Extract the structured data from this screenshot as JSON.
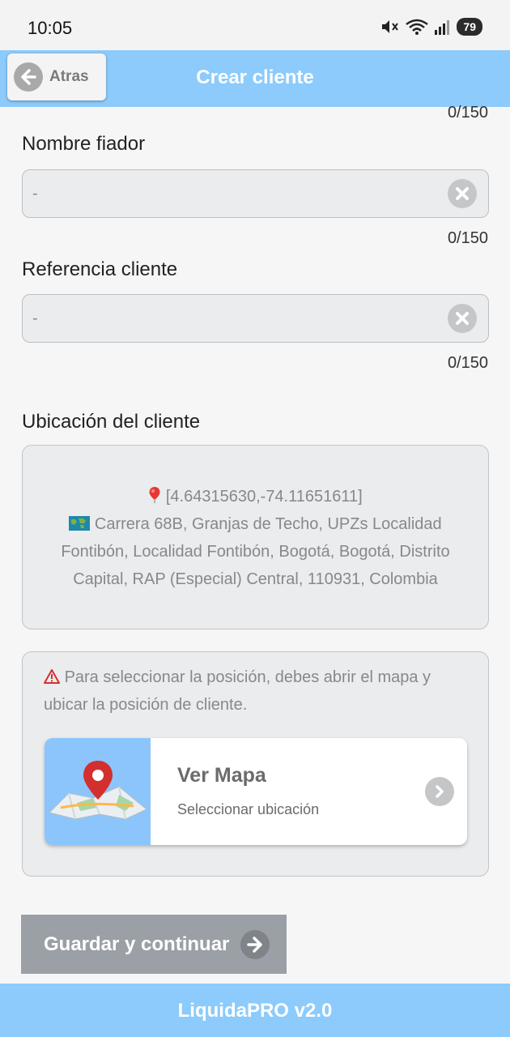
{
  "status_bar": {
    "time": "10:05",
    "battery": "79",
    "icons": [
      "mute-icon",
      "wifi-icon",
      "signal-icon",
      "battery-icon"
    ]
  },
  "header": {
    "back_label": "Atras",
    "title": "Crear cliente"
  },
  "form": {
    "top_counter": "0/150",
    "nombre_fiador": {
      "label": "Nombre fiador",
      "value": "-",
      "counter": "0/150"
    },
    "referencia_cliente": {
      "label": "Referencia cliente",
      "value": "-",
      "counter": "0/150"
    }
  },
  "ubicacion": {
    "label": "Ubicación del cliente",
    "coords": "[4.64315630,-74.11651611]",
    "address": "Carrera 68B, Granjas de Techo, UPZs Localidad Fontibón, Localidad Fontibón, Bogotá, Bogotá, Distrito Capital, RAP (Especial) Central, 110931, Colombia"
  },
  "map": {
    "warning": "Para seleccionar la posición, debes abrir el mapa y ubicar la posición de cliente.",
    "card_title": "Ver Mapa",
    "card_subtitle": "Seleccionar ubicación"
  },
  "actions": {
    "save_label": "Guardar y continuar"
  },
  "footer": {
    "label": "LiquidaPRO v2.0"
  },
  "colors": {
    "header_bg": "#8ccbfb",
    "button_bg": "#9aa0a5",
    "input_bg": "#ebeced",
    "page_bg": "#f6f6f6"
  }
}
